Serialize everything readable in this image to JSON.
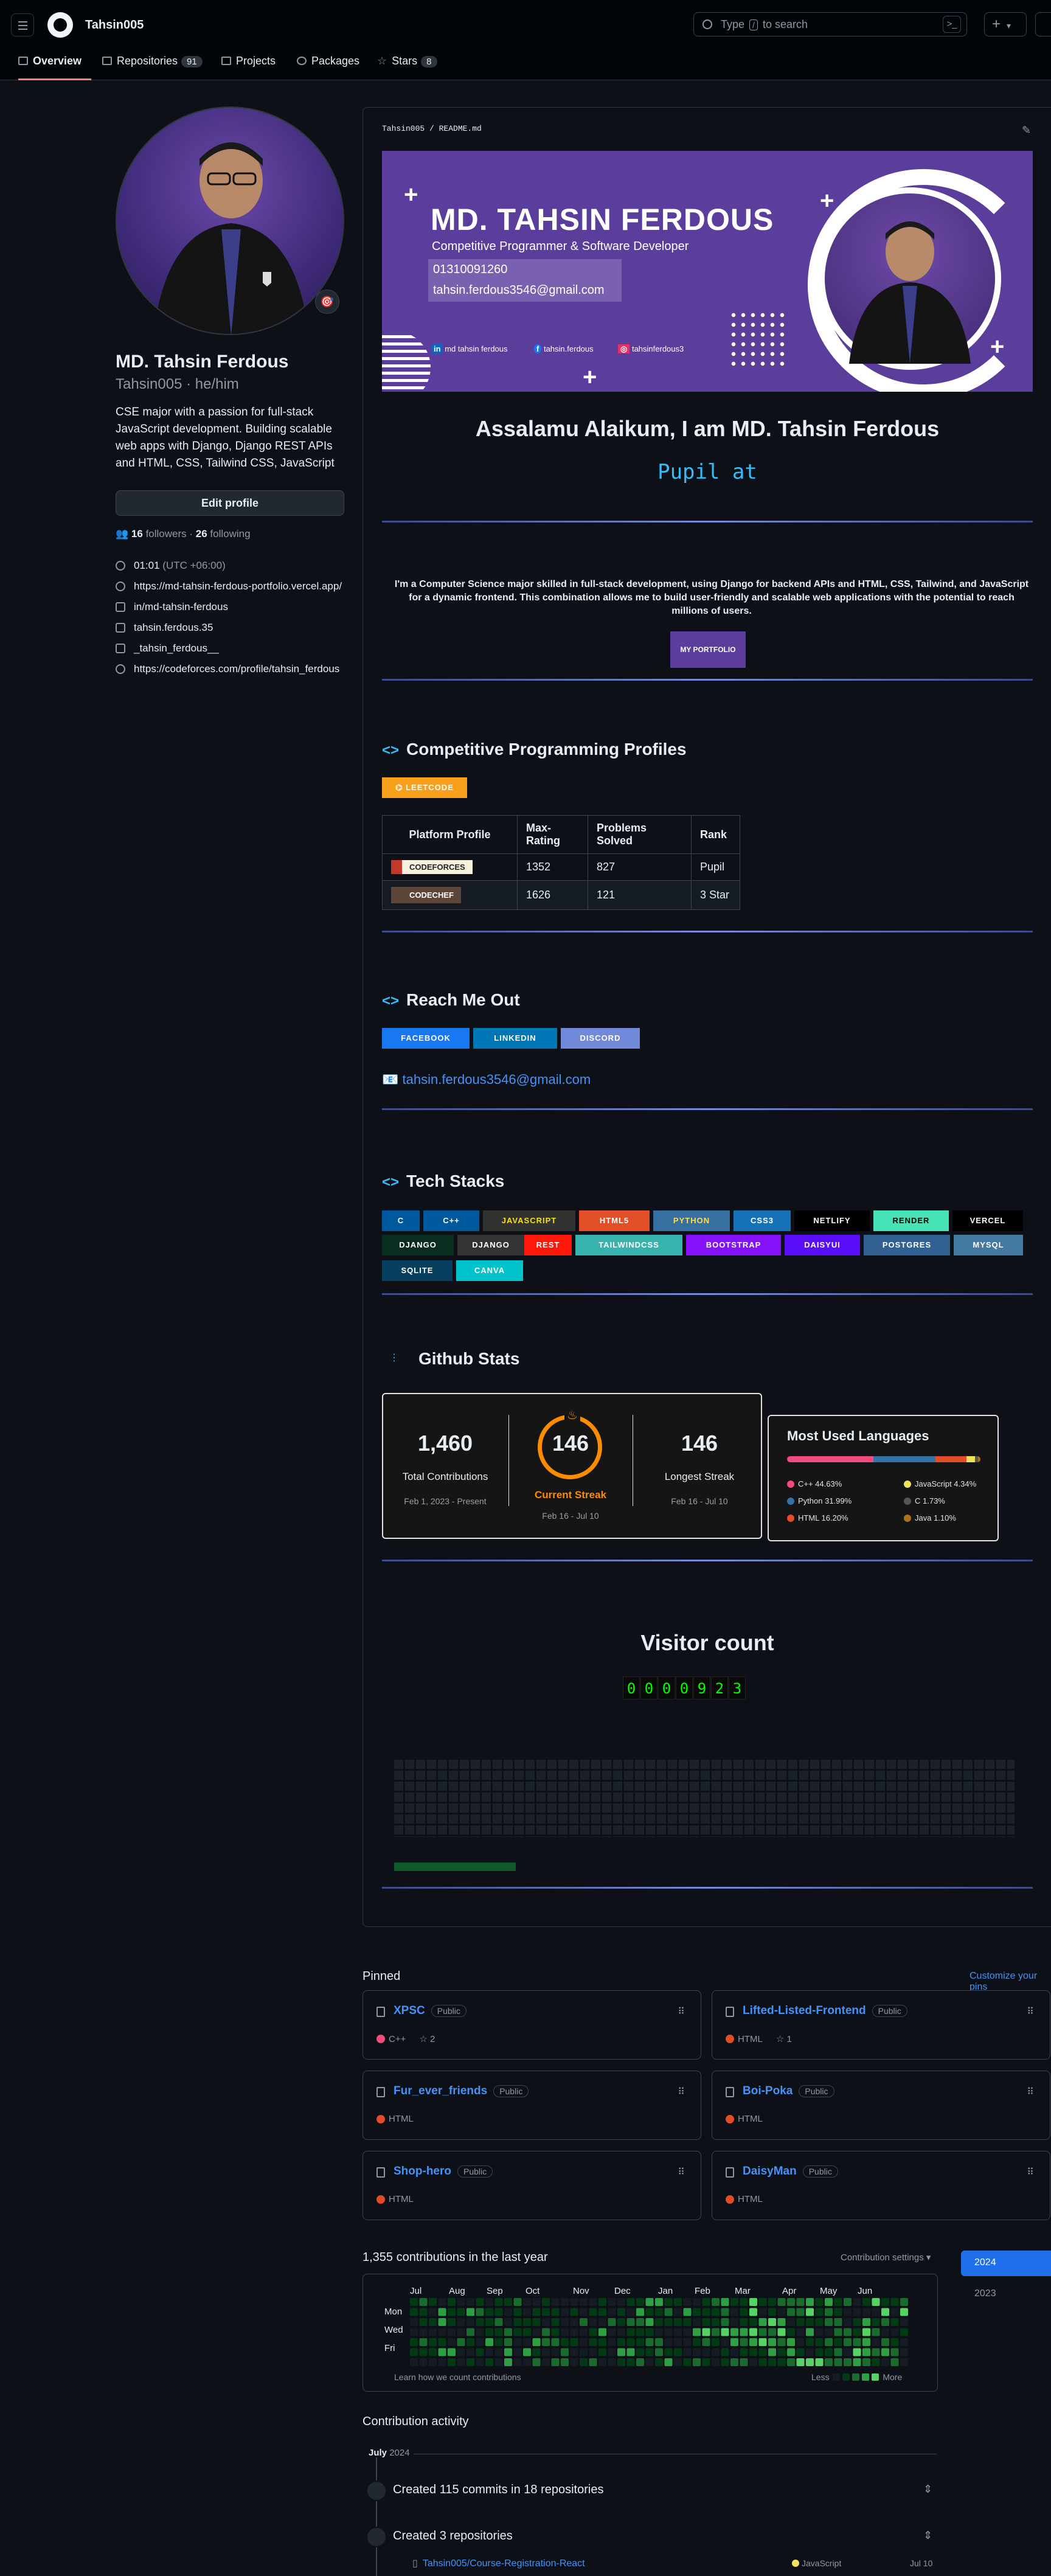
{
  "header": {
    "username": "Tahsin005",
    "search_placeholder_before": "Type",
    "search_key": "/",
    "search_placeholder_after": "to search",
    "plus_label": "+"
  },
  "tabs": [
    {
      "label": "Overview",
      "icon": "book-icon"
    },
    {
      "label": "Repositories",
      "count": "91",
      "icon": "repo-icon"
    },
    {
      "label": "Projects",
      "icon": "table-icon"
    },
    {
      "label": "Packages",
      "icon": "package-icon"
    },
    {
      "label": "Stars",
      "count": "8",
      "icon": "star-icon"
    }
  ],
  "profile": {
    "name": "MD. Tahsin Ferdous",
    "login_line": "Tahsin005 · he/him",
    "bio": "CSE major with a passion for full-stack JavaScript development. Building scalable web apps with Django, Django REST APIs and HTML, CSS, Tailwind CSS, JavaScript",
    "edit_label": "Edit profile",
    "followers": "16",
    "followers_label": "followers",
    "following": "26",
    "following_label": "following",
    "time": "01:01",
    "timezone": "(UTC +06:00)",
    "website": "https://md-tahsin-ferdous-portfolio.vercel.app/",
    "linkedin": "in/md-tahsin-ferdous",
    "facebook": "tahsin.ferdous.35",
    "instagram": "_tahsin_ferdous__",
    "codeforces": "https://codeforces.com/profile/tahsin_ferdous"
  },
  "readme": {
    "path": "Tahsin005 / README.md",
    "banner": {
      "name": "MD. TAHSIN FERDOUS",
      "role": "Competitive Programmer & Software Developer",
      "phone": "01310091260",
      "email": "tahsin.ferdous3546@gmail.com",
      "social_linkedin": "md tahsin ferdous",
      "social_facebook": "tahsin.ferdous",
      "social_instagram": "tahsinferdous3"
    },
    "greeting": "Assalamu Alaikum, I am MD. Tahsin Ferdous",
    "typing": "Pupil at",
    "about": "I'm a Computer Science major skilled in full-stack development, using Django for backend APIs and HTML, CSS, Tailwind, and JavaScript for a dynamic frontend. This combination allows me to build user-friendly and scalable web applications with the potential to reach millions of users.",
    "portfolio_btn": "MY PORTFOLIO",
    "cp_title": "Competitive Programming Profiles",
    "leetcode": "LEETCODE",
    "cp_table": {
      "headers": [
        "Platform Profile",
        "Max-Rating",
        "Problems Solved",
        "Rank"
      ],
      "rows": [
        {
          "platform": "CODEFORCES",
          "rating": "1352",
          "solved": "827",
          "rank": "Pupil"
        },
        {
          "platform": "CODECHEF",
          "rating": "1626",
          "solved": "121",
          "rank": "3 Star"
        }
      ]
    },
    "reach_title": "Reach Me Out",
    "reach_badges": [
      "FACEBOOK",
      "LINKEDIN",
      "DISCORD"
    ],
    "email_link": "tahsin.ferdous3546@gmail.com",
    "tech_title": "Tech Stacks",
    "tech_row1": [
      "C",
      "C++",
      "JAVASCRIPT",
      "HTML5",
      "PYTHON",
      "CSS3",
      "NETLIFY",
      "RENDER",
      "VERCEL"
    ],
    "tech_row2": [
      "DJANGO",
      "DJANGO",
      "REST",
      "TAILWINDCSS",
      "BOOTSTRAP",
      "DAISYUI",
      "POSTGRES",
      "MYSQL"
    ],
    "tech_row3": [
      "SQLITE",
      "CANVA"
    ],
    "stats_title": "Github Stats",
    "stats": {
      "total": "1,460",
      "total_label": "Total Contributions",
      "total_range": "Feb 1, 2023 - Present",
      "streak": "146",
      "streak_label": "Current Streak",
      "streak_range": "Feb 16 - Jul 10",
      "longest": "146",
      "longest_label": "Longest Streak",
      "longest_range": "Feb 16 - Jul 10"
    },
    "languages": {
      "title": "Most Used Languages",
      "items": [
        {
          "label": "C++ 44.63%",
          "pct": 44.63,
          "color": "#f34b7d"
        },
        {
          "label": "JavaScript 4.34%",
          "pct": 4.34,
          "color": "#f1e05a"
        },
        {
          "label": "Python 31.99%",
          "pct": 31.99,
          "color": "#3572A5"
        },
        {
          "label": "C 1.73%",
          "pct": 1.73,
          "color": "#555555"
        },
        {
          "label": "HTML 16.20%",
          "pct": 16.2,
          "color": "#e34c26"
        },
        {
          "label": "Java 1.10%",
          "pct": 1.1,
          "color": "#b07219"
        }
      ]
    },
    "visitor_title": "Visitor count",
    "visitor_digits": [
      "0",
      "0",
      "0",
      "0",
      "9",
      "2",
      "3"
    ]
  },
  "pinned": {
    "title": "Pinned",
    "customize": "Customize your pins",
    "public_label": "Public",
    "items": [
      {
        "name": "XPSC",
        "lang": "C++",
        "color": "#f34b7d",
        "stars": "2"
      },
      {
        "name": "Lifted-Listed-Frontend",
        "lang": "HTML",
        "color": "#e34c26",
        "stars": "1"
      },
      {
        "name": "Fur_ever_friends",
        "lang": "HTML",
        "color": "#e34c26"
      },
      {
        "name": "Boi-Poka",
        "lang": "HTML",
        "color": "#e34c26"
      },
      {
        "name": "Shop-hero",
        "lang": "HTML",
        "color": "#e34c26"
      },
      {
        "name": "DaisyMan",
        "lang": "HTML",
        "color": "#e34c26"
      }
    ]
  },
  "contributions": {
    "title": "1,355 contributions in the last year",
    "settings": "Contribution settings ▾",
    "months": [
      "Jul",
      "Aug",
      "Sep",
      "Oct",
      "Nov",
      "Dec",
      "Jan",
      "Feb",
      "Mar",
      "Apr",
      "May",
      "Jun"
    ],
    "weekdays": [
      "Mon",
      "Wed",
      "Fri"
    ],
    "learn": "Learn how we count contributions",
    "less": "Less",
    "more": "More",
    "years": [
      "2024",
      "2023"
    ]
  },
  "activity": {
    "title": "Contribution activity",
    "month": "July",
    "year": "2024",
    "item1": "Created 115 commits in 18 repositories",
    "item2": "Created 3 repositories",
    "repo1": "Tahsin005/Course-Registration-React",
    "repo1_lang": "JavaScript",
    "repo1_date": "Jul 10"
  }
}
